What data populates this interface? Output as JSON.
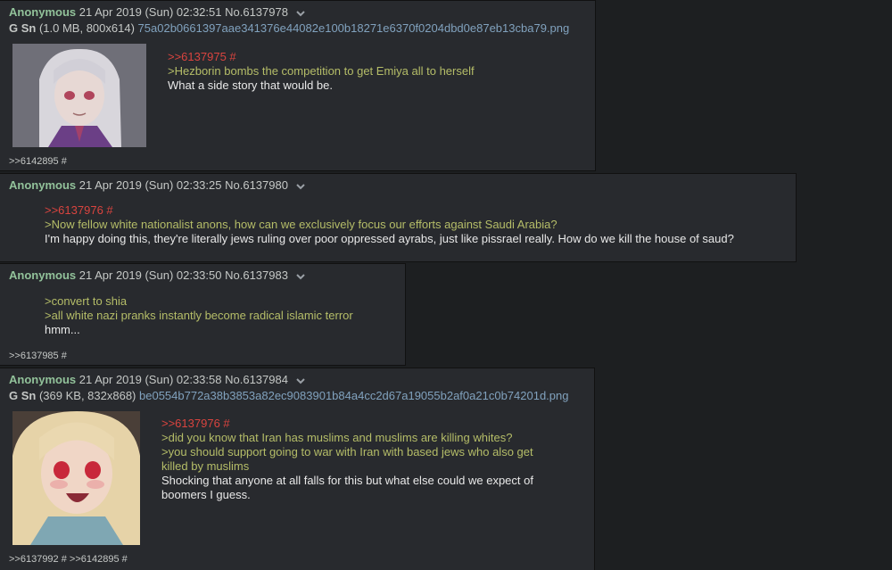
{
  "posts": [
    {
      "name": "Anonymous",
      "datetime": "21 Apr 2019 (Sun) 02:32:51",
      "number": "No.6137978",
      "file_tag": "G Sn",
      "file_info": "(1.0 MB, 800x614)",
      "file_hash": "75a02b0661397aae341376e44082e100b18271e6370f0204dbd0e87eb13cba79.png",
      "quote_link": ">>6137975 #",
      "greentext": [
        ">Hezborin bombs the competition to get Emiya all to herself"
      ],
      "text": [
        "What a side story that would be."
      ],
      "backlinks": ">>6142895 #"
    },
    {
      "name": "Anonymous",
      "datetime": "21 Apr 2019 (Sun) 02:33:25",
      "number": "No.6137980",
      "quote_link": ">>6137976 #",
      "greentext": [
        ">Now fellow white nationalist anons, how can we exclusively focus our efforts against Saudi Arabia?"
      ],
      "text": [
        "I'm happy doing this, they're literally jews ruling over poor oppressed ayrabs, just like pissrael really. How do we kill the house of saud?"
      ]
    },
    {
      "name": "Anonymous",
      "datetime": "21 Apr 2019 (Sun) 02:33:50",
      "number": "No.6137983",
      "greentext": [
        ">convert to shia",
        ">all white nazi pranks instantly become radical islamic terror"
      ],
      "text": [
        "hmm..."
      ],
      "backlinks": ">>6137985 #"
    },
    {
      "name": "Anonymous",
      "datetime": "21 Apr 2019 (Sun) 02:33:58",
      "number": "No.6137984",
      "file_tag": "G Sn",
      "file_info": "(369 KB, 832x868)",
      "file_hash": "be0554b772a38b3853a82ec9083901b84a4cc2d67a19055b2af0a21c0b74201d.png",
      "quote_link": ">>6137976 #",
      "greentext": [
        ">did you know that Iran has muslims and muslims are killing whites?",
        ">you should support going to war with Iran with based jews who also get",
        "killed by muslims"
      ],
      "text": [
        "Shocking that anyone at all falls for this but what else could we expect of",
        "boomers I guess."
      ],
      "backlinks": ">>6137992 # >>6142895 #"
    }
  ]
}
